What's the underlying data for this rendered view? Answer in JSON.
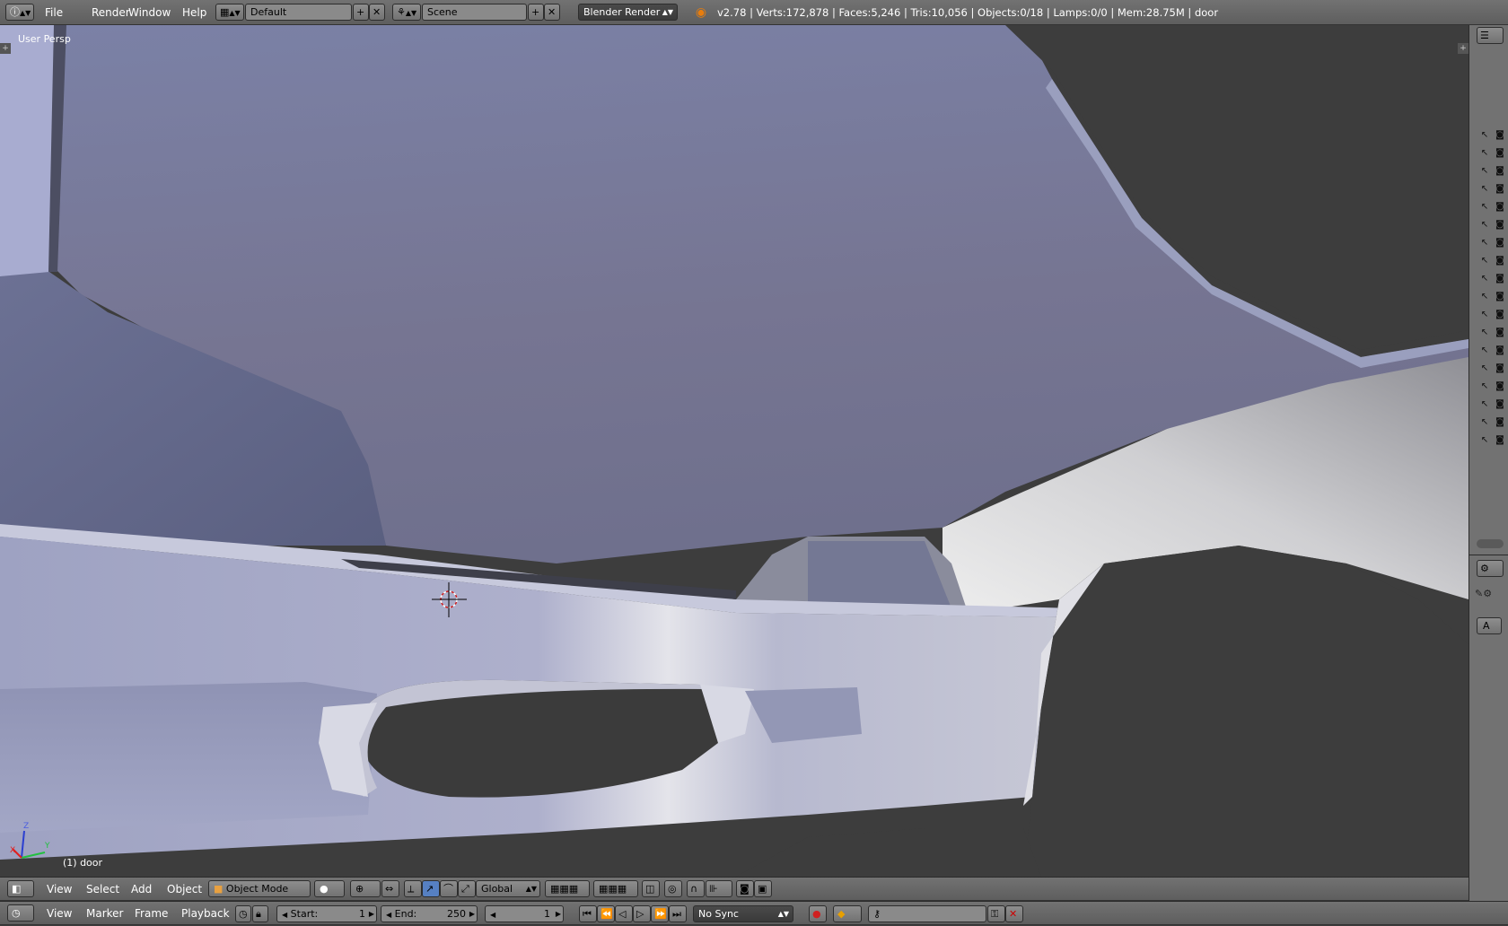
{
  "top_menu": {
    "file": "File",
    "render": "Render",
    "window": "Window",
    "help": "Help",
    "layout_name": "Default",
    "scene_name": "Scene",
    "engine": "Blender Render",
    "stats": "v2.78 | Verts:172,878 | Faces:5,246 | Tris:10,056 | Objects:0/18 | Lamps:0/0 | Mem:28.75M | door"
  },
  "viewport": {
    "view_name": "User Persp",
    "object_label": "(1) door",
    "axis_x": "X",
    "axis_y": "Y",
    "axis_z": "Z"
  },
  "view3d_header": {
    "view": "View",
    "select": "Select",
    "add": "Add",
    "object": "Object",
    "mode": "Object Mode",
    "orientation": "Global"
  },
  "timeline": {
    "view": "View",
    "marker": "Marker",
    "frame": "Frame",
    "playback": "Playback",
    "start_label": "Start:",
    "start_value": "1",
    "end_label": "End:",
    "end_value": "250",
    "current_frame": "1",
    "sync": "No Sync"
  },
  "properties_tab": "A",
  "icons": {
    "info": "info-icon",
    "layout": "screen-layout-icon",
    "scene": "scene-icon",
    "blender": "blender-logo-icon",
    "cursor": "3d-cursor-icon"
  },
  "colors": {
    "header_bg": "#6e6e6e",
    "viewport_bg": "#3d3d3d",
    "mesh_light": "#b8bcd8",
    "mesh_shadow": "#6d7396"
  }
}
